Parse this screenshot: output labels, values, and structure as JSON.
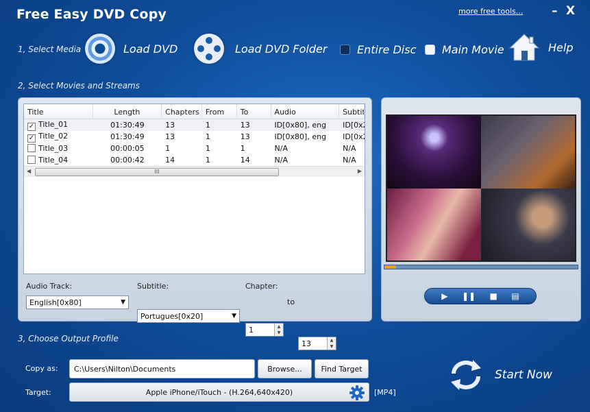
{
  "app": {
    "title": "Free Easy DVD Copy",
    "more_link": "more free tools...",
    "minimize": "–",
    "close": "X"
  },
  "step1": {
    "label": "1, Select Media",
    "load_dvd": "Load DVD",
    "load_folder": "Load DVD Folder",
    "entire_disc": "Entire Disc",
    "main_movie": "Main Movie",
    "help": "Help"
  },
  "step2": {
    "label": "2, Select Movies and Streams",
    "columns": [
      "Title",
      "Length",
      "Chapters",
      "From",
      "To",
      "Audio",
      "Subtitl"
    ],
    "rows": [
      {
        "checked": true,
        "title": "Title_01",
        "length": "01:30:49",
        "chapters": "13",
        "from": "1",
        "to": "13",
        "audio": "ID[0x80], eng",
        "subtitle": "ID[0x2"
      },
      {
        "checked": true,
        "title": "Title_02",
        "length": "01:30:49",
        "chapters": "13",
        "from": "1",
        "to": "13",
        "audio": "ID[0x80], eng",
        "subtitle": "ID[0x2"
      },
      {
        "checked": false,
        "title": "Title_03",
        "length": "00:00:05",
        "chapters": "1",
        "from": "1",
        "to": "1",
        "audio": "N/A",
        "subtitle": "N/A"
      },
      {
        "checked": false,
        "title": "Title_04",
        "length": "00:00:42",
        "chapters": "14",
        "from": "1",
        "to": "14",
        "audio": "N/A",
        "subtitle": "N/A"
      }
    ],
    "scroll_grip": "III",
    "audio_track_label": "Audio Track:",
    "audio_track_value": "English[0x80]",
    "subtitle_label": "Subtitle:",
    "subtitle_value": "Portugues[0x20]",
    "chapter_label": "Chapter:",
    "chapter_from": "1",
    "chapter_to_word": "to",
    "chapter_to": "13"
  },
  "preview": {
    "progress": 0.06,
    "play": "▶",
    "pause": "❚❚",
    "stop": "■",
    "snapshot": "▤"
  },
  "step3": {
    "label": "3, Choose Output Profile",
    "copy_as_label": "Copy as:",
    "copy_as_value": "C:\\Users\\Nilton\\Documents",
    "browse": "Browse...",
    "find_target": "Find Target",
    "target_label": "Target:",
    "target_value": "Apple iPhone/iTouch - (H.264,640x420)",
    "format_badge": "[MP4]",
    "start_now": "Start Now"
  },
  "colors": {
    "accent": "#1f6bc4",
    "background": "#0f4e9c",
    "progress_fill": "#e4a21b"
  }
}
